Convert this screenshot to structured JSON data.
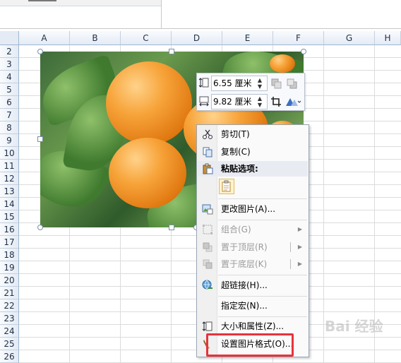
{
  "columns": [
    "A",
    "B",
    "C",
    "D",
    "E",
    "F",
    "G",
    "H"
  ],
  "rows": [
    "2",
    "3",
    "4",
    "5",
    "6",
    "7",
    "8",
    "9",
    "10",
    "11",
    "12",
    "13",
    "14",
    "15",
    "16",
    "17",
    "18",
    "19",
    "20",
    "21",
    "22",
    "23",
    "24",
    "25",
    "26"
  ],
  "picture": {
    "description": "apricots"
  },
  "mini_toolbar": {
    "height_value": "6.55 厘米",
    "width_value": "9.82 厘米",
    "icons": [
      "height-icon",
      "width-icon",
      "bring-forward-icon",
      "send-backward-icon",
      "crop-icon",
      "rotate-icon"
    ]
  },
  "context_menu": {
    "items": [
      {
        "label": "剪切(T)",
        "icon": "scissors-icon"
      },
      {
        "label": "复制(C)",
        "icon": "copy-icon"
      },
      {
        "label": "粘贴选项:",
        "icon": "paste-icon"
      },
      {
        "label": "更改图片(A)...",
        "icon": "change-picture-icon"
      },
      {
        "label": "组合(G)",
        "icon": "group-icon"
      },
      {
        "label": "置于顶层(R)",
        "icon": "bring-to-front-icon"
      },
      {
        "label": "置于底层(K)",
        "icon": "send-to-back-icon"
      },
      {
        "label": "超链接(H)...",
        "icon": "hyperlink-icon"
      },
      {
        "label": "指定宏(N)...",
        "icon": ""
      },
      {
        "label": "大小和属性(Z)...",
        "icon": "size-icon"
      },
      {
        "label": "设置图片格式(O)...",
        "icon": "format-picture-icon"
      }
    ]
  },
  "watermark": {
    "text": "Bai 经验"
  }
}
